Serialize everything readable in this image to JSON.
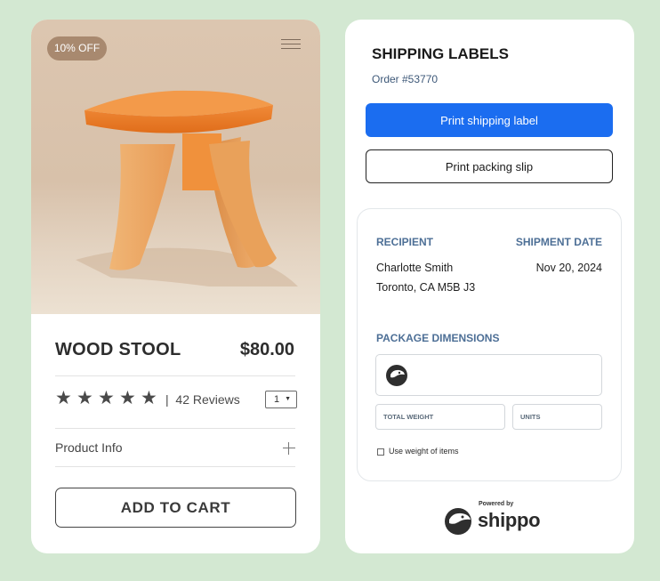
{
  "product": {
    "discount_badge": "10% OFF",
    "title": "WOOD STOOL",
    "price": "$80.00",
    "rating": 5,
    "reviews": "42 Reviews",
    "reviews_separator": "|",
    "quantity": "1",
    "product_info_label": "Product Info",
    "add_to_cart_label": "ADD TO CART"
  },
  "shipping": {
    "title": "SHIPPING LABELS",
    "order_number": "Order #53770",
    "print_label_button": "Print shipping label",
    "packing_slip_button": "Print packing slip",
    "recipient_label": "RECIPIENT",
    "recipient_name": "Charlotte Smith",
    "recipient_address": "Toronto, CA M5B J3",
    "shipment_date_label": "SHIPMENT DATE",
    "shipment_date": "Nov 20, 2024",
    "package_dimensions_label": "PACKAGE DIMENSIONS",
    "total_weight_placeholder": "TOTAL WEIGHT",
    "units_placeholder": "UNITS",
    "use_weight_label": "Use weight of items",
    "powered_by": "Powered by",
    "brand": "shippo"
  },
  "icons": {
    "menu": "hamburger-menu-icon",
    "star": "star-icon",
    "expand": "plus-icon",
    "package": "shippo-bird-icon"
  },
  "colors": {
    "background": "#d3e8d2",
    "primary_button": "#1b6df0",
    "badge": "#a8896f",
    "label_blue": "#4d6f96"
  }
}
